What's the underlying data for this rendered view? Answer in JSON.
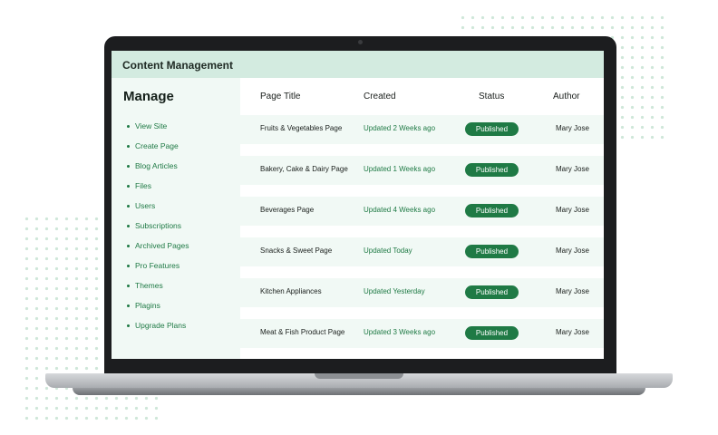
{
  "app": {
    "title": "Content Management"
  },
  "sidebar": {
    "heading": "Manage",
    "items": [
      {
        "label": "View Site"
      },
      {
        "label": "Create Page"
      },
      {
        "label": "Blog Articles"
      },
      {
        "label": "Files"
      },
      {
        "label": "Users"
      },
      {
        "label": "Subscriptions"
      },
      {
        "label": "Archived Pages"
      },
      {
        "label": "Pro Features"
      },
      {
        "label": "Themes"
      },
      {
        "label": "Plagins"
      },
      {
        "label": "Upgrade Plans"
      }
    ]
  },
  "table": {
    "columns": [
      "Page Title",
      "Created",
      "Status",
      "Author"
    ],
    "rows": [
      {
        "title": "Fruits & Vegetables Page",
        "created": "Updated 2 Weeks ago",
        "status": "Published",
        "author": "Mary Jose"
      },
      {
        "title": "Bakery, Cake & Dairy Page",
        "created": "Updated 1 Weeks ago",
        "status": "Published",
        "author": "Mary Jose"
      },
      {
        "title": "Beverages Page",
        "created": "Updated 4 Weeks ago",
        "status": "Published",
        "author": "Mary Jose"
      },
      {
        "title": "Snacks & Sweet Page",
        "created": "Updated Today",
        "status": "Published",
        "author": "Mary Jose"
      },
      {
        "title": "Kitchen Appliances",
        "created": "Updated Yesterday",
        "status": "Published",
        "author": "Mary Jose"
      },
      {
        "title": "Meat & Fish Product Page",
        "created": "Updated 3 Weeks ago",
        "status": "Published",
        "author": "Mary Jose"
      }
    ]
  },
  "colors": {
    "accent": "#1f7a45",
    "header_bg": "#d3ebe0",
    "panel_bg": "#f1f9f5",
    "decor_dots": "#cfe7d9"
  }
}
